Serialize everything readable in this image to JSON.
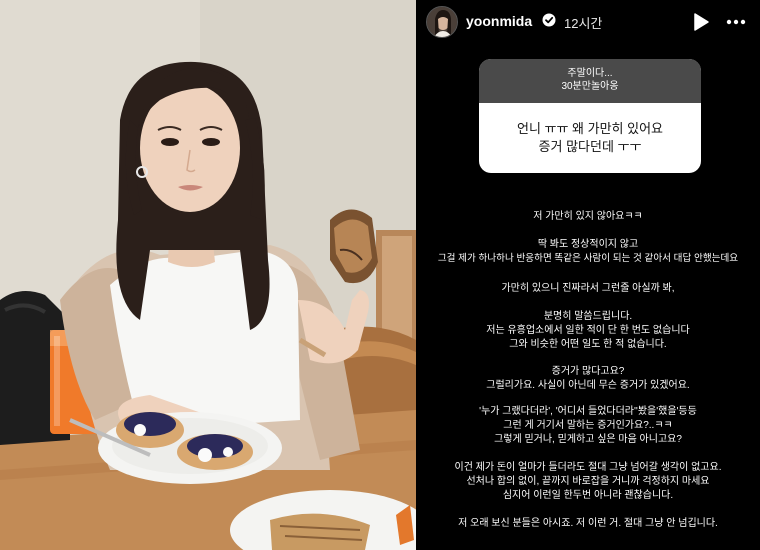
{
  "story": {
    "username": "yoonmida",
    "timestamp": "12시간",
    "icons": {
      "verified": "verified-badge-icon",
      "play": "play-icon",
      "more": "more-options-icon"
    },
    "question": {
      "header_line1": "주말이다...",
      "header_line2": "30분만놀아옹",
      "body_line1": "언니 ㅠㅠ 왜 가만히 있어요",
      "body_line2": "증거 많다던데 ㅜㅜ"
    },
    "lines": [
      "저 가만히 있지 않아요ㅋㅋ",
      "딱 봐도 정상적이지 않고",
      "그걸 제가 하나하나 반응하면 똑같은 사람이 되는 것 같아서 대답 안했는데요",
      "가만히 있으니 진짜라서 그런줄 아실까 봐,",
      "분명히 말씀드립니다.",
      "저는 유흥업소에서 일한 적이 단 한 번도 없습니다",
      "그와 비슷한 어떤 일도 한 적 없습니다.",
      "증거가 많다고요?",
      "그럴리가요. 사실이 아닌데 무슨 증거가 있겠어요.",
      "'누가 그랬다더라', '어디서 들었다더라''봤을'했을'등등",
      "그런 게 거기서 말하는 증거인가요?..ㅋㅋ",
      "그렇게 믿거나, 믿게하고 싶은 마음 아니고요?",
      "이건 제가 돈이 얼마가 들더라도 절대 그냥 넘어갈 생각이 없고요.",
      "선처나 합의 없이, 끝까지 바로잡을 거니까 걱정하지 마세요",
      "심지어 이런일 한두번 아니라 괜찮습니다.",
      "저 오래 보신 분들은 아시죠. 저 이런 거. 절대 그냥 안 넘깁니다."
    ]
  },
  "colors": {
    "story_bg": "#000000",
    "question_header_bg": "#4a4a4a",
    "question_body_bg": "#ffffff",
    "verified_blue": "#3897f0"
  }
}
